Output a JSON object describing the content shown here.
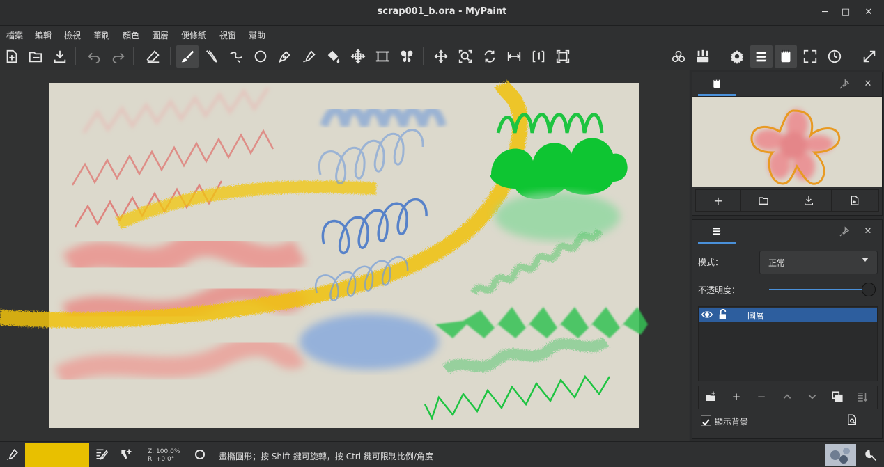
{
  "window": {
    "title": "scrap001_b.ora - MyPaint",
    "minimize_glyph": "─",
    "maximize_glyph": "□",
    "close_glyph": "✕"
  },
  "menu": [
    "檔案",
    "編輯",
    "檢視",
    "筆刷",
    "顏色",
    "圖層",
    "便條紙",
    "視窗",
    "幫助"
  ],
  "toolbar": {
    "icons": [
      "new-document-icon",
      "open-file-icon",
      "save-file-icon",
      "undo-icon",
      "redo-icon",
      "eraser-icon",
      "freehand-brush-icon",
      "inking-icon",
      "line-icon",
      "ellipse-icon",
      "bezier-pen-icon",
      "color-picker-icon",
      "fill-icon",
      "move-layer-icon",
      "frame-icon",
      "symmetry-icon",
      "pan-icon",
      "zoom-icon",
      "rotate-icon",
      "mirror-icon",
      "reset-view-icon",
      "fit-view-icon",
      "color-wheel-icon",
      "brushes-icon",
      "settings-icon",
      "layers-icon",
      "scratchpad-icon",
      "fullscreen-icon",
      "history-icon",
      "expand-icon"
    ]
  },
  "scratchpad_panel": {
    "tab_icon": "scratchpad-icon",
    "buttons": [
      "+",
      "open",
      "save",
      "revert"
    ]
  },
  "layers_panel": {
    "tab_icon": "layers-icon",
    "mode_label": "模式：",
    "mode_value": "正常",
    "opacity_label": "不透明度：",
    "opacity": 1.0,
    "layers": [
      {
        "name": "圖層",
        "visible": true,
        "locked": false,
        "selected": true
      }
    ],
    "show_background_label": "顯示背景",
    "show_background_checked": true
  },
  "status": {
    "color": "#e8c000",
    "zoom_text": "Z: 100.0%",
    "rotation_text": "R: +0.0°",
    "message": "畫橢圓形；按 Shift 鍵可旋轉，按 Ctrl 鍵可限制比例/角度"
  },
  "colors": {
    "canvas_bg": "#dcd9cc",
    "accent": "#4a90d9",
    "selection": "#2d5e9e"
  }
}
